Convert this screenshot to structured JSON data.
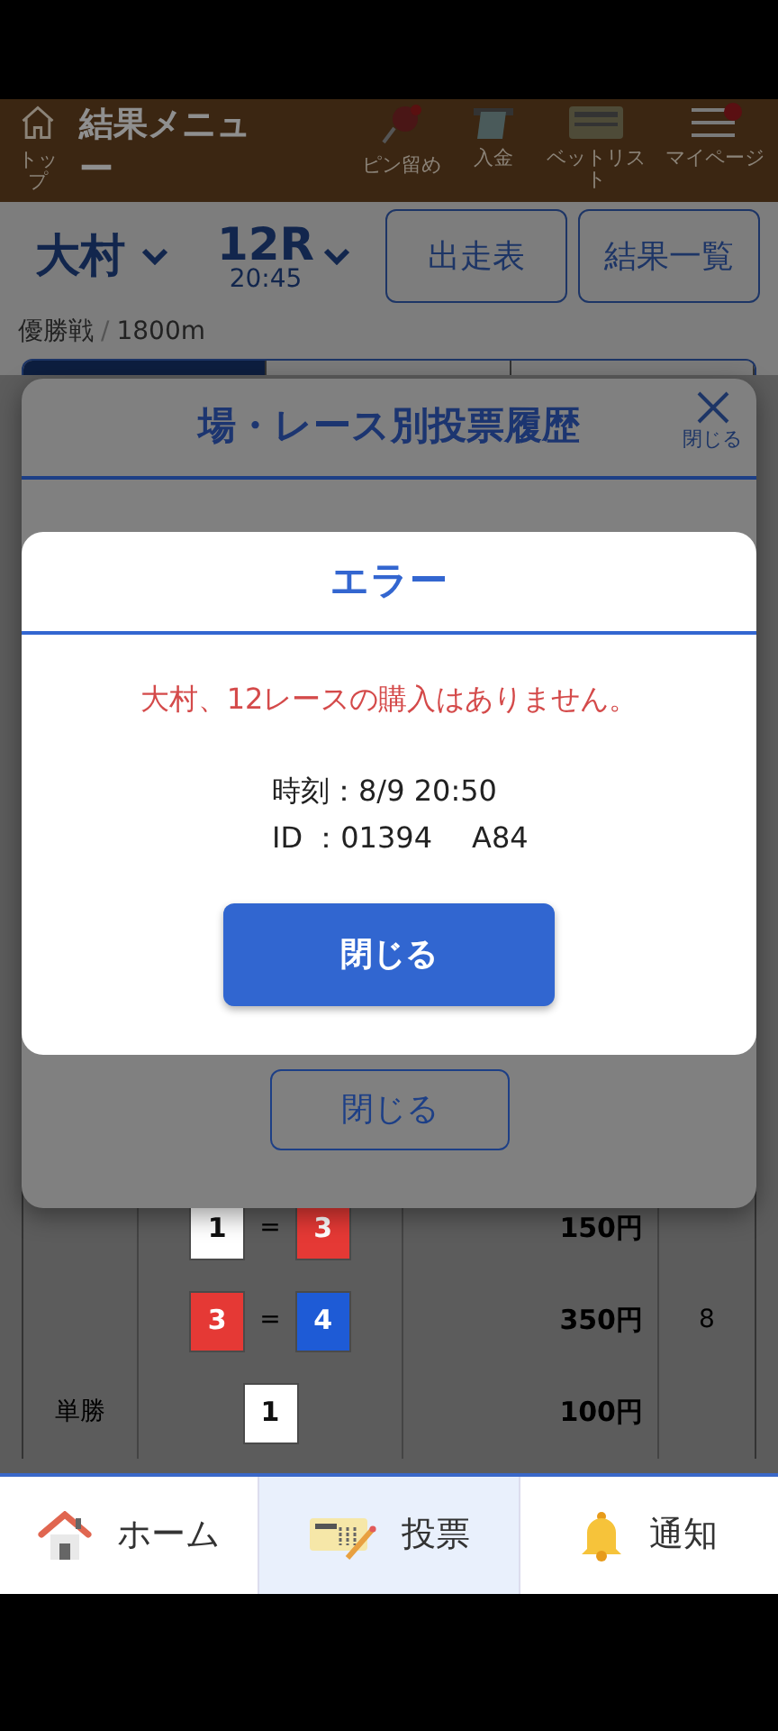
{
  "header": {
    "home_label": "トップ",
    "title": "結果メニュー",
    "items": [
      {
        "kind": "pin",
        "label": "ピン留め"
      },
      {
        "kind": "deposit",
        "label": "入金"
      },
      {
        "kind": "betlist",
        "label": "ベットリスト"
      },
      {
        "kind": "menu",
        "label": "マイページ",
        "alert": true
      }
    ]
  },
  "race": {
    "venue": "大村",
    "number": "12R",
    "time": "20:45",
    "buttons": [
      "出走表",
      "結果一覧"
    ],
    "grade": "優勝戦",
    "separator": "/",
    "distance": "1800m"
  },
  "tabs": [
    {
      "selected": true
    },
    {
      "selected": false
    },
    {
      "selected": false
    }
  ],
  "results": [
    {
      "combo": [
        {
          "number": "1",
          "color": "#ffffff"
        },
        {
          "number": "3",
          "color": "#e53935"
        }
      ],
      "joiner": "=",
      "amount": "150円"
    },
    {
      "combo": [
        {
          "number": "3",
          "color": "#e53935"
        },
        {
          "number": "4",
          "color": "#1e5bd6"
        }
      ],
      "joiner": "=",
      "amount": "350円",
      "column_4": "8"
    },
    {
      "bet_type": "単勝",
      "combo": [
        {
          "number": "1",
          "color": "#ffffff"
        }
      ],
      "amount": "100円"
    }
  ],
  "history_modal": {
    "title": "場・レース別投票履歴",
    "close_label": "閉じる",
    "close_button": "閉じる"
  },
  "error_dialog": {
    "title": "エラー",
    "message": "大村、12レースの購入はありません。",
    "time_line": "時刻：8/9 20:50",
    "id_parts": [
      "ID ：01394",
      "A84"
    ],
    "button": "閉じる"
  },
  "bottom_nav": [
    {
      "kind": "home",
      "label": "ホーム",
      "selected": false
    },
    {
      "kind": "vote",
      "label": "投票",
      "selected": true
    },
    {
      "kind": "notice",
      "label": "通知",
      "selected": false
    }
  ]
}
